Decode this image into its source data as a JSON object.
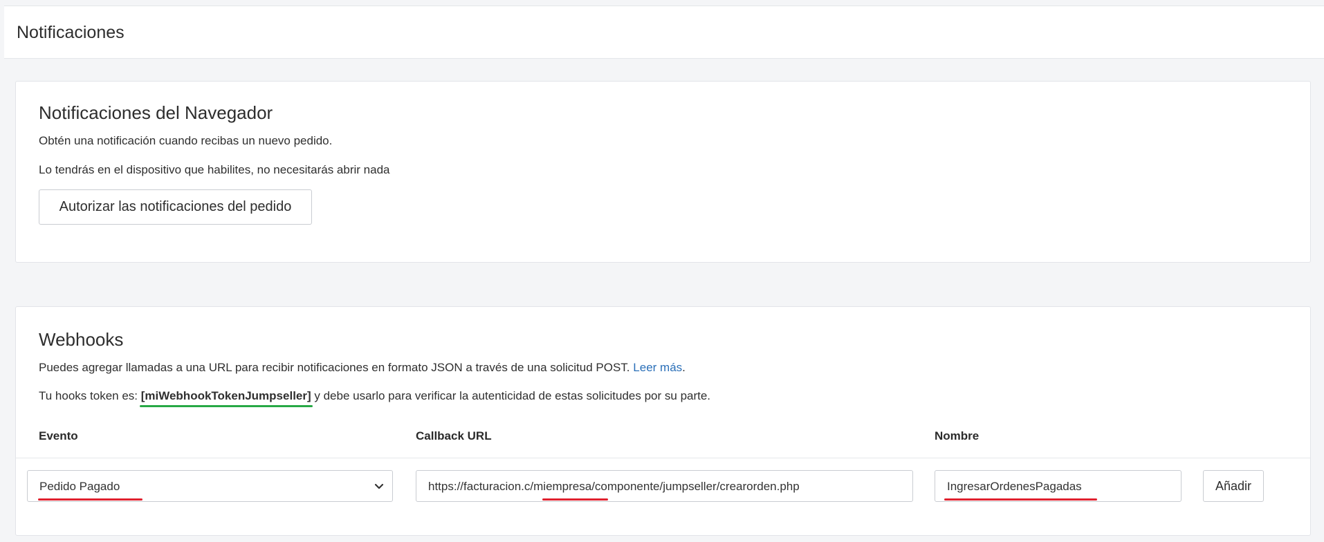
{
  "page": {
    "title": "Notificaciones"
  },
  "browser_notifications": {
    "title": "Notificaciones del Navegador",
    "description_1": "Obtén una notificación cuando recibas un nuevo pedido.",
    "description_2": "Lo tendrás en el dispositivo que habilites, no necesitarás abrir nada",
    "authorize_button": "Autorizar las notificaciones del pedido"
  },
  "webhooks": {
    "title": "Webhooks",
    "description": "Puedes agregar llamadas a una URL para recibir notificaciones en formato JSON a través de una solicitud POST.",
    "read_more_link": "Leer más",
    "read_more_suffix": ".",
    "token_prefix": "Tu hooks token es: ",
    "token_value": "[miWebhookTokenJumpseller]",
    "token_suffix": " y debe usarlo para verificar la autenticidad de estas solicitudes por su parte.",
    "columns": {
      "event": "Evento",
      "callback_url": "Callback URL",
      "name": "Nombre"
    },
    "form": {
      "event_selected": "Pedido Pagado",
      "callback_url_value": "https://facturacion.c/miempresa/componente/jumpseller/crearorden.php",
      "name_value": "IngresarOrdenesPagadas",
      "add_button": "Añadir"
    }
  },
  "colors": {
    "link": "#2a6fb8",
    "highlight_green": "#27a845",
    "highlight_red": "#e0202e",
    "border": "#c9ccd1"
  },
  "icons": {
    "select_arrow": "chevron-down-icon"
  }
}
